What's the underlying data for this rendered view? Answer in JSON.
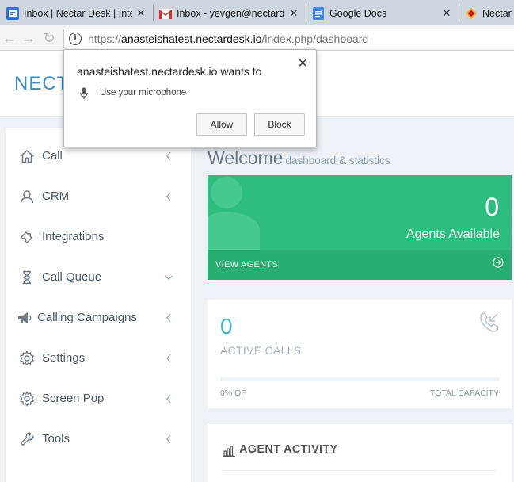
{
  "browser": {
    "tabs": [
      {
        "title": "Inbox | Nectar Desk | Inte",
        "favicon": "nectar-helpdesk-icon"
      },
      {
        "title": "Inbox - yevgen@nectard",
        "favicon": "gmail-icon"
      },
      {
        "title": "Google Docs",
        "favicon": "google-docs-icon"
      },
      {
        "title": "Nectar D",
        "favicon": "nectar-icon"
      }
    ],
    "url": {
      "protocol": "https://",
      "host": "anasteishatest.nectardesk.io",
      "path": "/index.php/dashboard"
    }
  },
  "permission_popup": {
    "message": "anasteishatest.nectardesk.io wants to",
    "request": "Use your microphone",
    "allow_label": "Allow",
    "block_label": "Block"
  },
  "header": {
    "brand": "NECTA"
  },
  "sidebar": {
    "items": [
      {
        "label": "Call",
        "icon": "home-icon",
        "chevron": "left"
      },
      {
        "label": "CRM",
        "icon": "user-icon",
        "chevron": "left"
      },
      {
        "label": "Integrations",
        "icon": "puzzle-icon",
        "chevron": ""
      },
      {
        "label": "Call Queue",
        "icon": "hourglass-icon",
        "chevron": "down"
      },
      {
        "label": "Calling Campaigns",
        "icon": "megaphone-icon",
        "chevron": "left"
      },
      {
        "label": "Settings",
        "icon": "gear-icon",
        "chevron": "left"
      },
      {
        "label": "Screen Pop",
        "icon": "gear-icon",
        "chevron": "left"
      },
      {
        "label": "Tools",
        "icon": "wrench-icon",
        "chevron": "left"
      }
    ]
  },
  "main": {
    "title": "Welcome",
    "subtitle": "dashboard & statistics",
    "agents": {
      "count": "0",
      "label": "Agents Available",
      "link": "VIEW AGENTS"
    },
    "calls": {
      "count": "0",
      "label": "ACTIVE CALLS",
      "percent_label": "0% OF",
      "capacity_label": "TOTAL CAPACITY",
      "progress_percent": 0
    },
    "activity": {
      "title": "AGENT ACTIVITY"
    }
  },
  "colors": {
    "brand_blue": "#3c8dbc",
    "green": "#2dbe7f",
    "teal": "#3fb5c6"
  }
}
